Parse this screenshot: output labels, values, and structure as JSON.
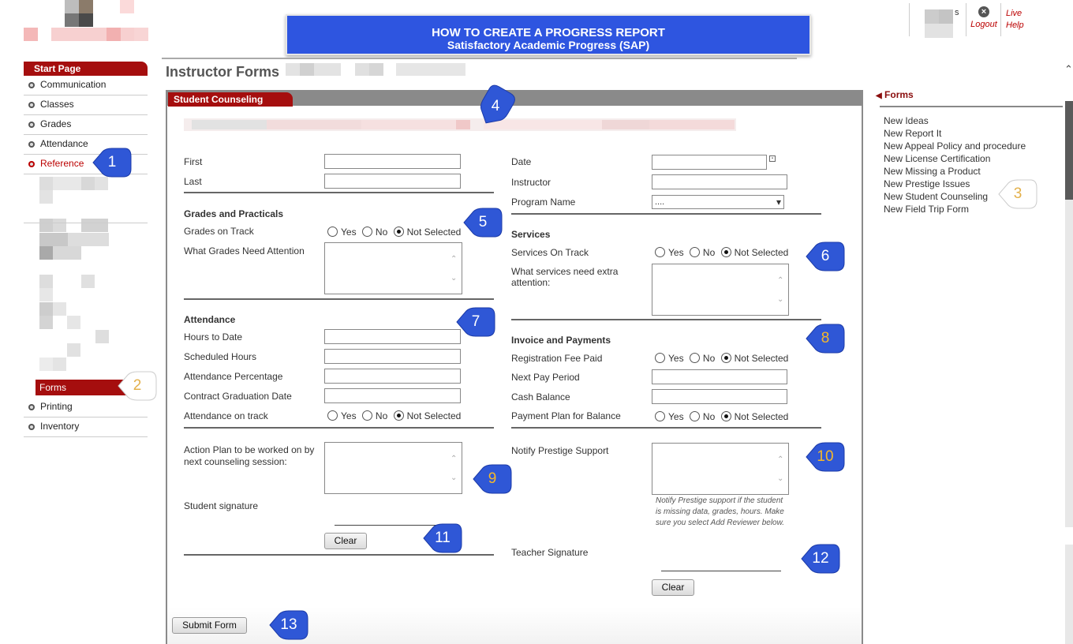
{
  "banner": {
    "title": "HOW TO CREATE A PROGRESS REPORT",
    "subtitle": "Satisfactory Academic Progress (SAP)"
  },
  "top_right": {
    "logout": "Logout",
    "live": "Live",
    "help": "Help",
    "user_fragment": "s"
  },
  "sidebar": {
    "header": "Start Page",
    "items": [
      "Communication",
      "Classes",
      "Grades",
      "Attendance",
      "Reference"
    ],
    "forms": "Forms",
    "bottom_items": [
      "Printing",
      "Inventory"
    ]
  },
  "page": {
    "title": "Instructor Forms",
    "panel_title": "Student Counseling"
  },
  "form": {
    "first": "First",
    "last": "Last",
    "date": "Date",
    "instructor": "Instructor",
    "program_name": "Program Name",
    "program_value": "....",
    "grades_section": "Grades and Practicals",
    "grades_on_track": "Grades on Track",
    "grades_attention": "What Grades Need Attention",
    "services_section": "Services",
    "services_on_track": "Services On Track",
    "services_attention": "What services need extra attention:",
    "attendance_section": "Attendance",
    "hours_to_date": "Hours to Date",
    "scheduled_hours": "Scheduled Hours",
    "attendance_pct": "Attendance Percentage",
    "contract_grad": "Contract Graduation Date",
    "attendance_on_track": "Attendance on track",
    "invoice_section": "Invoice and Payments",
    "registration_fee": "Registration Fee Paid",
    "next_pay": "Next Pay Period",
    "cash_balance": "Cash Balance",
    "payment_plan": "Payment Plan for Balance",
    "action_plan": "Action Plan to be worked on by next counseling session:",
    "notify_support": "Notify Prestige Support",
    "notify_help": "Notify Prestige support if the student is missing data, grades, hours. Make sure you select Add Reviewer below.",
    "student_signature": "Student signature",
    "teacher_signature": "Teacher Signature",
    "clear": "Clear",
    "submit": "Submit Form",
    "yes": "Yes",
    "no": "No",
    "not_selected": "Not Selected"
  },
  "right_panel": {
    "title": "Forms",
    "links": [
      "New Ideas",
      "New Report It",
      "New Appeal Policy and procedure",
      "New License Certification",
      "New Missing a Product",
      "New Prestige Issues",
      "New Student Counseling",
      "New Field Trip Form"
    ]
  },
  "callouts": [
    "1",
    "2",
    "3",
    "4",
    "5",
    "6",
    "7",
    "8",
    "9",
    "10",
    "11",
    "12",
    "13"
  ],
  "colors": {
    "banner": "#2e55e0",
    "accent": "#a50e0e",
    "callout": "#2f57d6",
    "callout_alt": "#ffffff"
  }
}
